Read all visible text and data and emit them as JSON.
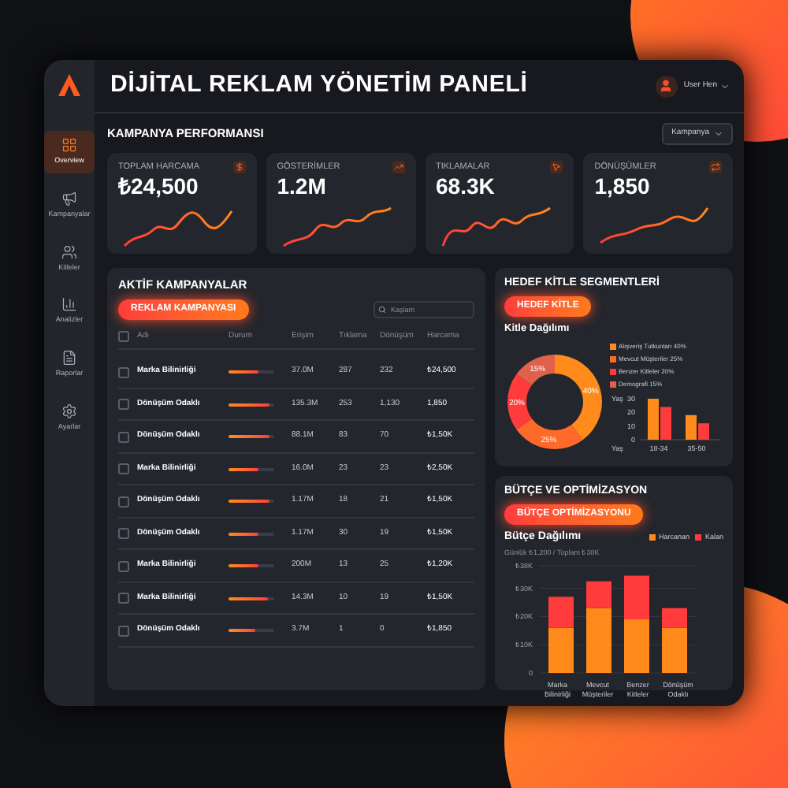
{
  "app": {
    "title": "DİJİTAL REKLAM YÖNETİM PANELİ",
    "user": "User Hen"
  },
  "sidebar": {
    "items": [
      {
        "label": "Overview",
        "selected": true
      },
      {
        "label": "Kampanyalar",
        "selected": false
      },
      {
        "label": "Kitleler",
        "selected": false
      },
      {
        "label": "Analizler",
        "selected": false
      },
      {
        "label": "Raporlar",
        "selected": false
      },
      {
        "label": "Ayarlar",
        "selected": false
      }
    ]
  },
  "performance": {
    "title": "KAMPANYA PERFORMANSI",
    "filter": "Kampanya",
    "cards": [
      {
        "label": "TOPLAM HARCAMA",
        "value": "₺24,500"
      },
      {
        "label": "GÖSTERİMLER",
        "value": "1.2M"
      },
      {
        "label": "TIKLAMALAR",
        "value": "68.3K"
      },
      {
        "label": "DÖNÜŞÜMLER",
        "value": "1,850"
      }
    ]
  },
  "campaigns": {
    "title": "AKTİF KAMPANYALAR",
    "button": "REKLAM KAMPANYASI",
    "search": {
      "placeholder": "Kaşlam"
    },
    "columns": [
      "Adı",
      "Durum",
      "Erişim",
      "Tıklama",
      "Dönüşüm",
      "Harcama"
    ],
    "header_checked": false,
    "rows": [
      {
        "checked": false,
        "name": "Marka Bilinirliği",
        "level": 0.65,
        "reach": "37.0M",
        "clicks": "287",
        "conversions": "232",
        "spend": "₺24,500"
      },
      {
        "checked": false,
        "name": "Dönüşüm Odaklı",
        "level": 0.9,
        "reach": "135.3M",
        "clicks": "253",
        "conversions": "1,130",
        "spend": "1,850"
      },
      {
        "checked": false,
        "name": "Dönüşüm Odaklı",
        "level": 0.9,
        "reach": "88.1M",
        "clicks": "83",
        "conversions": "70",
        "spend": "₺1,50K"
      },
      {
        "checked": false,
        "name": "Marka Bilinirliği",
        "level": 0.65,
        "reach": "16.0M",
        "clicks": "23",
        "conversions": "23",
        "spend": "₺2,50K"
      },
      {
        "checked": false,
        "name": "Dönüşüm Odaklı",
        "level": 0.9,
        "reach": "1.17M",
        "clicks": "18",
        "conversions": "21",
        "spend": "₺1,50K"
      },
      {
        "checked": false,
        "name": "Dönüşüm Odaklı",
        "level": 0.65,
        "reach": "1.17M",
        "clicks": "30",
        "conversions": "19",
        "spend": "₺1,50K"
      },
      {
        "checked": false,
        "name": "Marka Bilinirliği",
        "level": 0.65,
        "reach": "200M",
        "clicks": "13",
        "conversions": "25",
        "spend": "₺1,20K"
      },
      {
        "checked": false,
        "name": "Marka Bilinirliği",
        "level": 0.85,
        "reach": "14.3M",
        "clicks": "10",
        "conversions": "19",
        "spend": "₺1,50K"
      },
      {
        "checked": false,
        "name": "Dönüşüm Odaklı",
        "level": 0.6,
        "reach": "3.7M",
        "clicks": "1",
        "conversions": "0",
        "spend": "₺1,850"
      }
    ]
  },
  "audience": {
    "title": "HEDEF KİTLE SEGMENTLERİ",
    "button": "HEDEF KİTLE",
    "chart_data": {
      "type": "donut",
      "title": "Kitle Dağılımı",
      "legend": "right",
      "categories": [
        "Alışveriş Tutkunları 40%",
        "Mevcut Müşteriler 25%",
        "Benzer Kitleler 20%",
        "Demografi 15%"
      ],
      "values": [
        40,
        25,
        20,
        15
      ],
      "colors": [
        "#ff8c1a",
        "#ff6a2a",
        "#ff3b3b",
        "#e0604a"
      ],
      "value_labels": [
        "40%",
        "25%",
        "20%",
        "15%"
      ]
    },
    "age_chart": {
      "chart_data": {
        "type": "bar",
        "ylabel": "Yaş",
        "xlabel": "Yaş",
        "categories": [
          "18-34",
          "35-50"
        ],
        "series": [
          {
            "color": "#ff8c1a",
            "values": [
              30,
              18
            ]
          },
          {
            "color": "#ff3b3b",
            "values": [
              24,
              12
            ]
          }
        ],
        "ylim": [
          0,
          30
        ],
        "yticks": [
          0,
          10,
          20,
          30
        ]
      }
    }
  },
  "budget": {
    "title": "BÜTÇE VE OPTİMİZASYON",
    "button": "BÜTÇE OPTİMİZASYONU",
    "chart_data": {
      "type": "bar",
      "title": "Bütçe Dağılımı",
      "subtitle": "Günlük ₺1,200 / Toplam ₺38K",
      "stacked": true,
      "legend": "top",
      "grid": true,
      "categories": [
        "Marka Bilinirliği",
        "Mevcut Müşteriler",
        "Benzer Kitleler",
        "Dönüşüm Odaklı"
      ],
      "series": [
        {
          "name": "Harcanan",
          "color": "#ff8a1a",
          "values": [
            16,
            23,
            19,
            16
          ]
        },
        {
          "name": "Kalan",
          "color": "#ff3b3b",
          "values": [
            11,
            9.5,
            15.5,
            7
          ]
        }
      ],
      "ylim": [
        0,
        38
      ],
      "yticks": [
        {
          "value": 0,
          "label": "0"
        },
        {
          "value": 10,
          "label": "₺10K"
        },
        {
          "value": 20,
          "label": "₺20K"
        },
        {
          "value": 30,
          "label": "₺30K"
        },
        {
          "value": 38,
          "label": "₺38K"
        }
      ]
    }
  }
}
